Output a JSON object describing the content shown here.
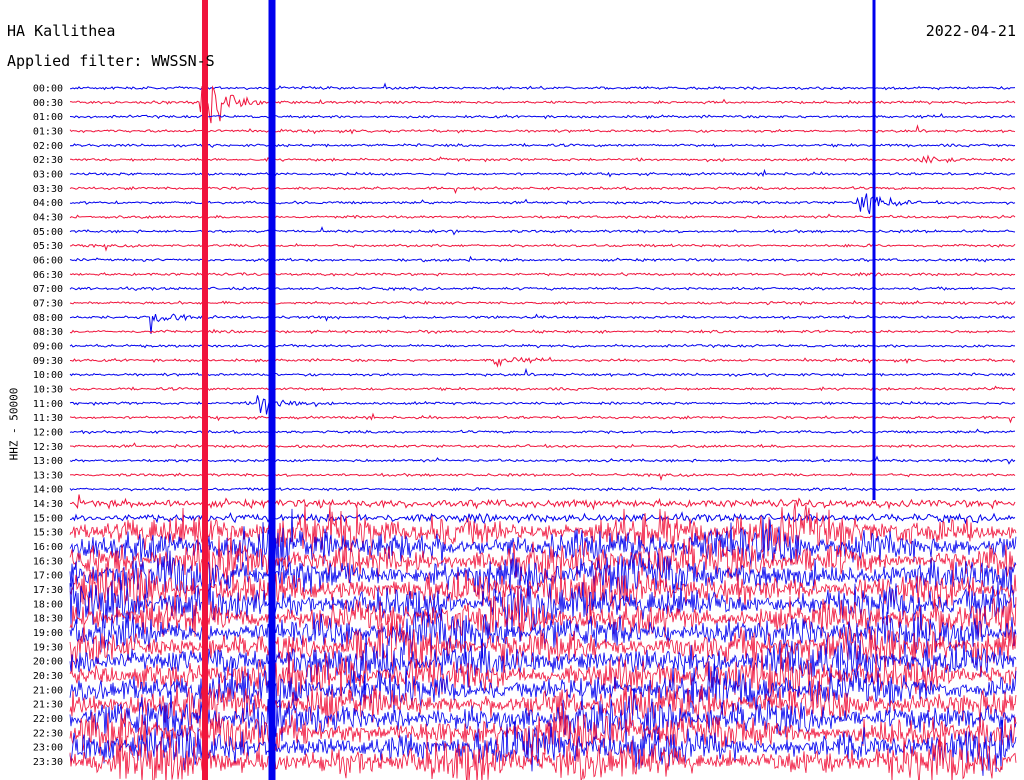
{
  "header": {
    "station": "HA Kallithea",
    "filter": "Applied filter: WWSSN-S",
    "date": "2022-04-21"
  },
  "chart_data": {
    "type": "line",
    "title": "HA Kallithea",
    "subtitle": "Applied filter: WWSSN-S",
    "date": "2022-04-21",
    "ylabel": "HHZ - 50000",
    "xlabel": "",
    "colors": [
      "#0000ee",
      "#f0143c"
    ],
    "ticks": [
      "00:00",
      "00:30",
      "01:00",
      "01:30",
      "02:00",
      "02:30",
      "03:00",
      "03:30",
      "04:00",
      "04:30",
      "05:00",
      "05:30",
      "06:00",
      "06:30",
      "07:00",
      "07:30",
      "08:00",
      "08:30",
      "09:00",
      "09:30",
      "10:00",
      "10:30",
      "11:00",
      "11:30",
      "12:00",
      "12:30",
      "13:00",
      "13:30",
      "14:00",
      "14:30",
      "15:00",
      "15:30",
      "16:00",
      "16:30",
      "17:00",
      "17:30",
      "18:00",
      "18:30",
      "19:00",
      "19:30",
      "20:00",
      "20:30",
      "21:00",
      "21:30",
      "22:00",
      "22:30",
      "23:00",
      "23:30"
    ],
    "traces_description": "Helicorder: 48 half-hour traces alternating blue/red; quiet 00:00-14:30 with large events near 00:30, 04:00, 08:00, 11:00; high noise from 15:30 to 23:30",
    "events": [
      {
        "time": "00:30",
        "minute_offset": 4.2,
        "amplitude": "saturated"
      },
      {
        "time": "04:00",
        "minute_offset": 25.0,
        "amplitude": "large"
      },
      {
        "time": "08:00",
        "minute_offset": 2.6,
        "amplitude": "medium"
      },
      {
        "time": "11:00",
        "minute_offset": 6.0,
        "amplitude": "large"
      },
      {
        "time": "02:30",
        "minute_offset": 26.8,
        "amplitude": "small"
      },
      {
        "time": "09:30",
        "minute_offset": 13.5,
        "amplitude": "small"
      }
    ]
  }
}
